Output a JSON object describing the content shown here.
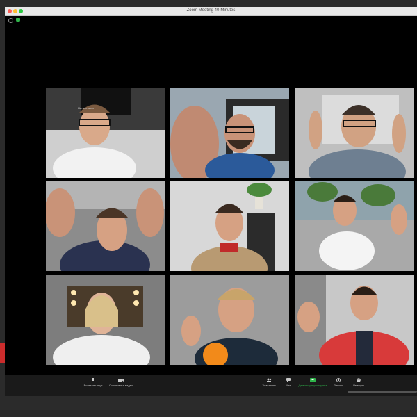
{
  "window": {
    "title": "Zoom Meeting  40-Minutes"
  },
  "tiles": [
    {
      "id": "p1",
      "screen_text": "Нет сигнала"
    },
    {
      "id": "p2"
    },
    {
      "id": "p3"
    },
    {
      "id": "p4"
    },
    {
      "id": "p5"
    },
    {
      "id": "p6"
    },
    {
      "id": "p7"
    },
    {
      "id": "p8"
    },
    {
      "id": "p9"
    }
  ],
  "toolbar": {
    "mute": "Включить звук",
    "video": "Остановить видео",
    "participants": "Участники",
    "chat": "Чат",
    "share": "Демонстрация экрана",
    "record": "Запись",
    "reactions": "Реакции"
  },
  "colors": {
    "share_accent": "#2fb44a",
    "side_red": "#cc2c2c"
  }
}
